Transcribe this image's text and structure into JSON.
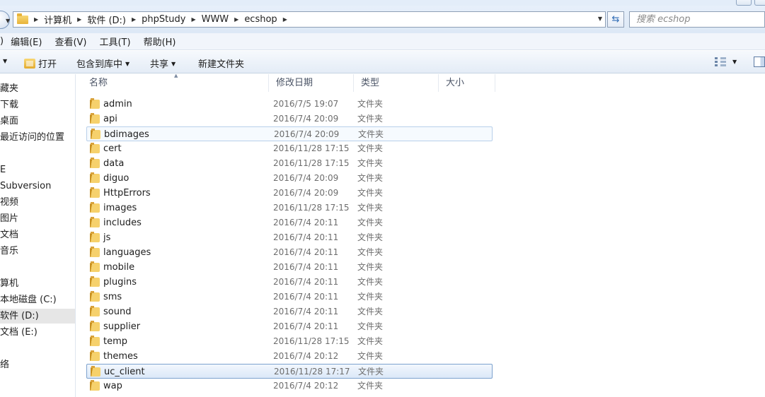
{
  "address_bar": {
    "breadcrumbs": [
      "计算机",
      "软件 (D:)",
      "phpStudy",
      "WWW",
      "ecshop"
    ],
    "search_placeholder": "搜索 ecshop"
  },
  "menu": {
    "items": [
      ")",
      "编辑(E)",
      "查看(V)",
      "工具(T)",
      "帮助(H)"
    ]
  },
  "toolbar": {
    "open_label": "打开",
    "include_library_label": "包含到库中",
    "share_label": "共享",
    "new_folder_label": "新建文件夹"
  },
  "nav_pane": {
    "items": [
      "藏夹",
      "下载",
      "桌面",
      "最近访问的位置",
      "E",
      "Subversion",
      "视频",
      "图片",
      "文档",
      "音乐",
      "算机",
      "本地磁盘 (C:)",
      "软件 (D:)",
      "文档 (E:)",
      "络"
    ],
    "selected": "软件 (D:)"
  },
  "file_list": {
    "columns": [
      "名称",
      "修改日期",
      "类型",
      "大小"
    ],
    "rows": [
      {
        "name": "admin",
        "date": "2016/7/5 19:07",
        "type": "文件夹"
      },
      {
        "name": "api",
        "date": "2016/7/4 20:09",
        "type": "文件夹"
      },
      {
        "name": "bdimages",
        "date": "2016/7/4 20:09",
        "type": "文件夹"
      },
      {
        "name": "cert",
        "date": "2016/11/28 17:15",
        "type": "文件夹"
      },
      {
        "name": "data",
        "date": "2016/11/28 17:15",
        "type": "文件夹"
      },
      {
        "name": "diguo",
        "date": "2016/7/4 20:09",
        "type": "文件夹"
      },
      {
        "name": "HttpErrors",
        "date": "2016/7/4 20:09",
        "type": "文件夹"
      },
      {
        "name": "images",
        "date": "2016/11/28 17:15",
        "type": "文件夹"
      },
      {
        "name": "includes",
        "date": "2016/7/4 20:11",
        "type": "文件夹"
      },
      {
        "name": "js",
        "date": "2016/7/4 20:11",
        "type": "文件夹"
      },
      {
        "name": "languages",
        "date": "2016/7/4 20:11",
        "type": "文件夹"
      },
      {
        "name": "mobile",
        "date": "2016/7/4 20:11",
        "type": "文件夹"
      },
      {
        "name": "plugins",
        "date": "2016/7/4 20:11",
        "type": "文件夹"
      },
      {
        "name": "sms",
        "date": "2016/7/4 20:11",
        "type": "文件夹"
      },
      {
        "name": "sound",
        "date": "2016/7/4 20:11",
        "type": "文件夹"
      },
      {
        "name": "supplier",
        "date": "2016/7/4 20:11",
        "type": "文件夹"
      },
      {
        "name": "temp",
        "date": "2016/11/28 17:15",
        "type": "文件夹"
      },
      {
        "name": "themes",
        "date": "2016/7/4 20:12",
        "type": "文件夹"
      },
      {
        "name": "uc_client",
        "date": "2016/11/28 17:17",
        "type": "文件夹"
      },
      {
        "name": "wap",
        "date": "2016/7/4 20:12",
        "type": "文件夹"
      }
    ],
    "selected_row": "uc_client",
    "hover_row": "bdimages"
  },
  "colors": {
    "selection_border": "#7da2ce",
    "selection_fill": "#dbe8f8",
    "folder_yellow": "#f6d16c"
  }
}
